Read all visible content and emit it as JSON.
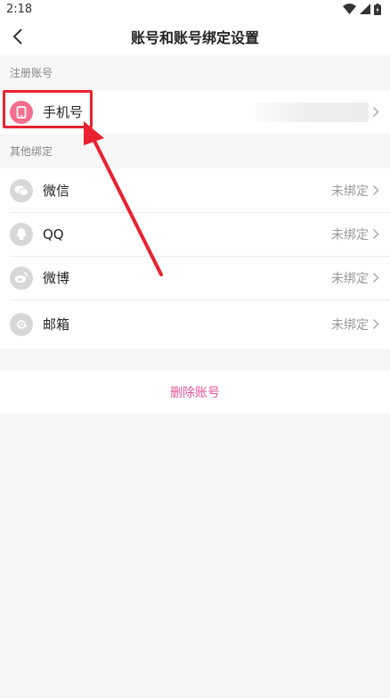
{
  "status_bar": {
    "time": "2:18"
  },
  "nav": {
    "title": "账号和账号绑定设置"
  },
  "registered": {
    "header": "注册账号",
    "items": [
      {
        "label": "手机号",
        "icon": "phone-icon"
      }
    ]
  },
  "other": {
    "header": "其他绑定",
    "items": [
      {
        "label": "微信",
        "value": "未绑定",
        "icon": "wechat-icon"
      },
      {
        "label": "QQ",
        "value": "未绑定",
        "icon": "qq-icon"
      },
      {
        "label": "微博",
        "value": "未绑定",
        "icon": "weibo-icon"
      },
      {
        "label": "邮箱",
        "value": "未绑定",
        "icon": "mail-icon"
      }
    ]
  },
  "delete_label": "删除账号",
  "colors": {
    "accent": "#e4559a",
    "phone_icon_bg": "#f46f8d",
    "annotation": "#e8232f"
  }
}
